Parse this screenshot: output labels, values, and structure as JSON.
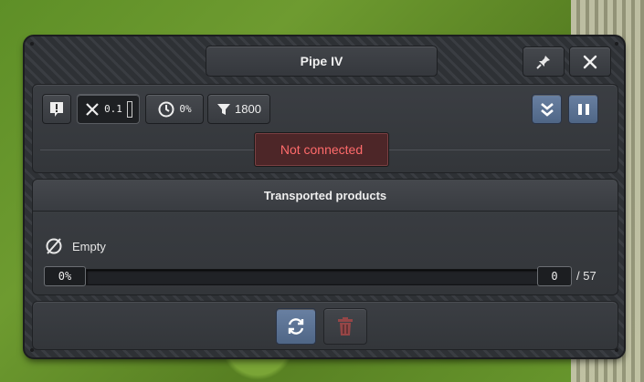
{
  "window": {
    "title": "Pipe IV",
    "pin_icon": "pin-icon",
    "close_icon": "close-icon"
  },
  "toolbar": {
    "info_icon": "info-icon",
    "tools_value": "0.1",
    "speed_value": "0%",
    "filter_value": "1800",
    "collapse_icon": "double-chevron-down-icon",
    "pause_icon": "pause-icon"
  },
  "status": {
    "text": "Not connected",
    "color": "#ff6b6b"
  },
  "products": {
    "heading": "Transported products",
    "empty_label": "Empty",
    "fill_percent_label": "0%",
    "fill_fraction": 0,
    "current": "0",
    "capacity": "/ 57"
  },
  "actions": {
    "refresh_icon": "refresh-icon",
    "delete_icon": "trash-icon"
  },
  "colors": {
    "accent_blue": "#6980a2",
    "danger": "#b54a4a"
  }
}
